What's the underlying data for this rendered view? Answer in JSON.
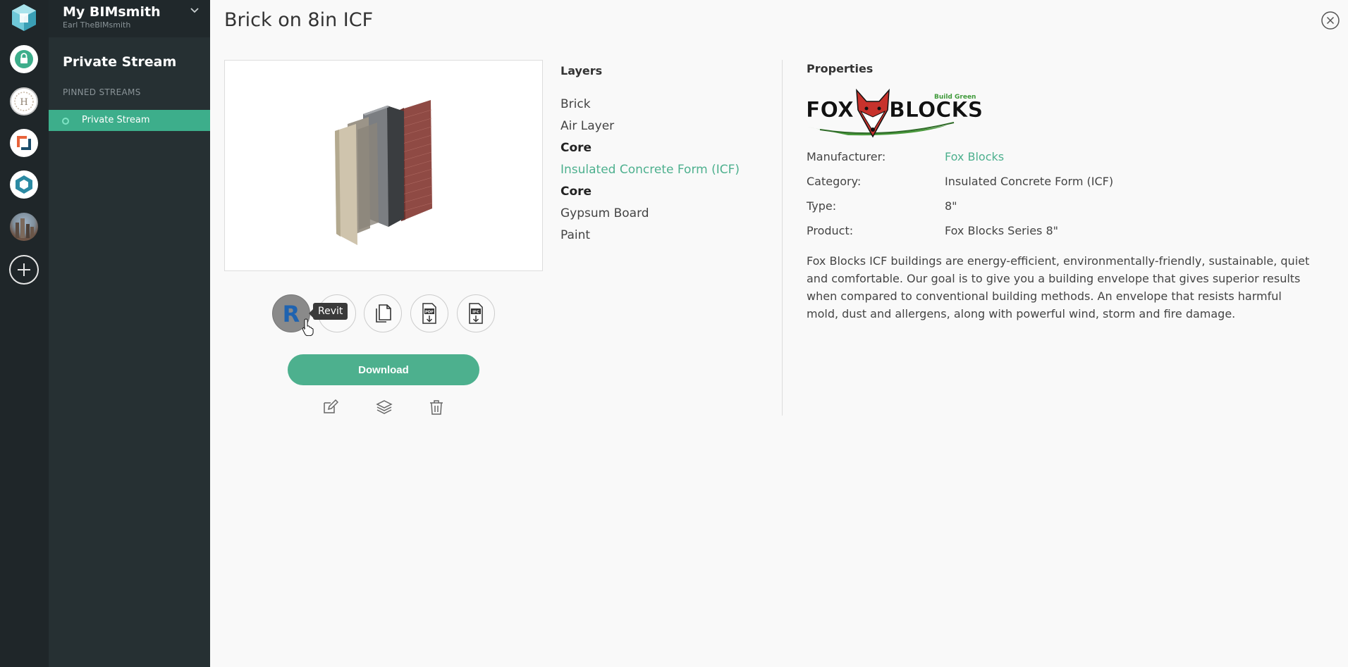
{
  "sidebar": {
    "workspace_title": "My BIMsmith",
    "user_name": "Earl TheBIMsmith",
    "stream_title": "Private Stream",
    "section_label": "PINNED STREAMS",
    "items": [
      {
        "label": "Private Stream",
        "active": true
      }
    ]
  },
  "rail": {
    "logo_icon": "bimsmith-cube-logo",
    "buttons": [
      {
        "name": "private-stream",
        "icon": "lock-icon"
      },
      {
        "name": "h-stream",
        "icon": "h-badge-icon",
        "text": "H"
      },
      {
        "name": "app-stream-1",
        "icon": "bracket-logo-icon"
      },
      {
        "name": "app-stream-2",
        "icon": "hex-logo-icon"
      },
      {
        "name": "photo-stream",
        "icon": "city-photo"
      },
      {
        "name": "add-stream",
        "icon": "plus-icon"
      }
    ]
  },
  "main": {
    "title": "Brick on 8in ICF",
    "tooltip": "Revit",
    "download_label": "Download",
    "layers_heading": "Layers",
    "layers": [
      {
        "label": "Brick",
        "style": "normal"
      },
      {
        "label": "Air Layer",
        "style": "normal"
      },
      {
        "label": "Core",
        "style": "core"
      },
      {
        "label": "Insulated Concrete Form (ICF)",
        "style": "link"
      },
      {
        "label": "Core",
        "style": "core"
      },
      {
        "label": "Gypsum Board",
        "style": "normal"
      },
      {
        "label": "Paint",
        "style": "normal"
      }
    ],
    "properties_heading": "Properties",
    "brand": {
      "logo_text": "FOX BLOCKS",
      "tagline": "Build Green"
    },
    "properties": [
      {
        "key": "Manufacturer:",
        "value": "Fox Blocks",
        "link": true
      },
      {
        "key": "Category:",
        "value": "Insulated Concrete Form (ICF)",
        "link": false
      },
      {
        "key": "Type:",
        "value": "8\"",
        "link": false
      },
      {
        "key": "Product:",
        "value": "Fox Blocks Series 8\"",
        "link": false
      }
    ],
    "description": "Fox Blocks ICF buildings are energy-efficient, environmentally-friendly, sustainable, quiet and comfortable. Our goal is to give you a building envelope that gives superior results when compared to conventional building methods. An envelope that resists harmful mold, dust and allergens, along with powerful wind, storm and fire damage."
  },
  "format_buttons": [
    {
      "name": "revit",
      "icon": "revit-icon",
      "label": "R"
    },
    {
      "name": "second-format",
      "icon": "red-format-icon"
    },
    {
      "name": "copy",
      "icon": "copy-icon"
    },
    {
      "name": "pdf",
      "icon": "pdf-download-icon",
      "label": "PDF"
    },
    {
      "name": "ifc",
      "icon": "ifc-download-icon",
      "label": "IFC"
    }
  ],
  "colors": {
    "accent": "#4db08e",
    "rail_bg": "#1f2629",
    "sidebar_bg": "#263033",
    "active_item": "#3dae8b"
  }
}
